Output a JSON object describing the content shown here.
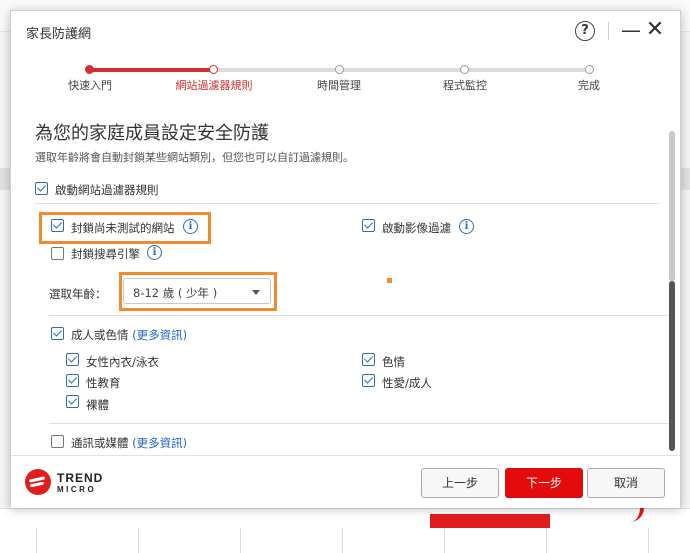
{
  "dialog": {
    "title": "家長防護網",
    "help_label": "?",
    "minimize_label": "—",
    "close_label": "✕"
  },
  "steps": [
    {
      "label": "快速入門",
      "state": "done"
    },
    {
      "label": "網站過濾器規則",
      "state": "current"
    },
    {
      "label": "時間管理",
      "state": "todo"
    },
    {
      "label": "程式監控",
      "state": "todo"
    },
    {
      "label": "完成",
      "state": "todo"
    }
  ],
  "content": {
    "heading": "為您的家庭成員設定安全防護",
    "subheading": "選取年齡將會自動封鎖某些網站類別，但您也可以自訂過濾規則。",
    "enable_filter": {
      "label": "啟動網站過濾器規則",
      "checked": true
    },
    "block_untested": {
      "label": "封鎖尚未測試的網站",
      "checked": true
    },
    "block_search": {
      "label": "封鎖搜尋引擎",
      "checked": false
    },
    "image_filter": {
      "label": "啟動影像過濾",
      "checked": true
    },
    "info_glyph": "i",
    "age": {
      "label": "選取年齡：",
      "selected": "8-12 歲 ( 少年 )"
    },
    "adult": {
      "label": "成人或色情",
      "more": "(更多資訊)",
      "checked": true,
      "items": [
        {
          "label": "女性內衣/泳衣",
          "checked": true
        },
        {
          "label": "色情",
          "checked": true
        },
        {
          "label": "性教育",
          "checked": true
        },
        {
          "label": "性愛/成人",
          "checked": true
        },
        {
          "label": "裸體",
          "checked": true
        }
      ]
    },
    "comm": {
      "label": "通訊或媒體",
      "more": "(更多資訊)",
      "checked": false
    }
  },
  "footer": {
    "logo_line1": "TREND",
    "logo_line2": "MICRO",
    "prev_label": "上一步",
    "next_label": "下一步",
    "cancel_label": "取消"
  },
  "colors": {
    "accent": "#d32f2f",
    "checkbox": "#2e6db4",
    "highlight": "#f08b2d",
    "primary_button": "#e30b0b"
  }
}
